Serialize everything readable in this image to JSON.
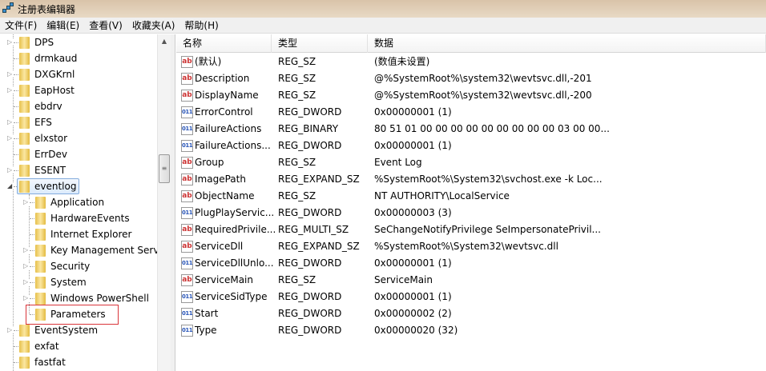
{
  "window": {
    "title": "注册表编辑器"
  },
  "menu": [
    "文件(F)",
    "编辑(E)",
    "查看(V)",
    "收藏夹(A)",
    "帮助(H)"
  ],
  "tree": [
    {
      "label": "DPS",
      "level": 1,
      "expandable": true
    },
    {
      "label": "drmkaud",
      "level": 1,
      "expandable": false
    },
    {
      "label": "DXGKrnl",
      "level": 1,
      "expandable": true
    },
    {
      "label": "EapHost",
      "level": 1,
      "expandable": true
    },
    {
      "label": "ebdrv",
      "level": 1,
      "expandable": false
    },
    {
      "label": "EFS",
      "level": 1,
      "expandable": true
    },
    {
      "label": "elxstor",
      "level": 1,
      "expandable": true
    },
    {
      "label": "ErrDev",
      "level": 1,
      "expandable": false
    },
    {
      "label": "ESENT",
      "level": 1,
      "expandable": true
    },
    {
      "label": "eventlog",
      "level": 1,
      "expandable": true,
      "expanded": true,
      "selected": true
    },
    {
      "label": "Application",
      "level": 2,
      "expandable": true
    },
    {
      "label": "HardwareEvents",
      "level": 2,
      "expandable": false
    },
    {
      "label": "Internet Explorer",
      "level": 2,
      "expandable": false
    },
    {
      "label": "Key Management Servi",
      "level": 2,
      "expandable": true
    },
    {
      "label": "Security",
      "level": 2,
      "expandable": true
    },
    {
      "label": "System",
      "level": 2,
      "expandable": true
    },
    {
      "label": "Windows PowerShell",
      "level": 2,
      "expandable": true
    },
    {
      "label": "Parameters",
      "level": 2,
      "expandable": false,
      "highlighted": true
    },
    {
      "label": "EventSystem",
      "level": 1,
      "expandable": true
    },
    {
      "label": "exfat",
      "level": 1,
      "expandable": false
    },
    {
      "label": "fastfat",
      "level": 1,
      "expandable": false
    }
  ],
  "columns": {
    "name": "名称",
    "type": "类型",
    "data": "数据"
  },
  "values": [
    {
      "icon": "string",
      "name": "(默认)",
      "type": "REG_SZ",
      "data": "(数值未设置)"
    },
    {
      "icon": "string",
      "name": "Description",
      "type": "REG_SZ",
      "data": "@%SystemRoot%\\system32\\wevtsvc.dll,-201"
    },
    {
      "icon": "string",
      "name": "DisplayName",
      "type": "REG_SZ",
      "data": "@%SystemRoot%\\system32\\wevtsvc.dll,-200"
    },
    {
      "icon": "binary",
      "name": "ErrorControl",
      "type": "REG_DWORD",
      "data": "0x00000001 (1)"
    },
    {
      "icon": "binary",
      "name": "FailureActions",
      "type": "REG_BINARY",
      "data": "80 51 01 00 00 00 00 00 00 00 00 00 03 00 00..."
    },
    {
      "icon": "binary",
      "name": "FailureActions...",
      "type": "REG_DWORD",
      "data": "0x00000001 (1)"
    },
    {
      "icon": "string",
      "name": "Group",
      "type": "REG_SZ",
      "data": "Event Log"
    },
    {
      "icon": "string",
      "name": "ImagePath",
      "type": "REG_EXPAND_SZ",
      "data": "%SystemRoot%\\System32\\svchost.exe -k Loc..."
    },
    {
      "icon": "string",
      "name": "ObjectName",
      "type": "REG_SZ",
      "data": "NT AUTHORITY\\LocalService"
    },
    {
      "icon": "binary",
      "name": "PlugPlayServic...",
      "type": "REG_DWORD",
      "data": "0x00000003 (3)"
    },
    {
      "icon": "string",
      "name": "RequiredPrivile...",
      "type": "REG_MULTI_SZ",
      "data": "SeChangeNotifyPrivilege SeImpersonatePrivil..."
    },
    {
      "icon": "string",
      "name": "ServiceDll",
      "type": "REG_EXPAND_SZ",
      "data": "%SystemRoot%\\System32\\wevtsvc.dll"
    },
    {
      "icon": "binary",
      "name": "ServiceDllUnlo...",
      "type": "REG_DWORD",
      "data": "0x00000001 (1)"
    },
    {
      "icon": "string",
      "name": "ServiceMain",
      "type": "REG_SZ",
      "data": "ServiceMain"
    },
    {
      "icon": "binary",
      "name": "ServiceSidType",
      "type": "REG_DWORD",
      "data": "0x00000001 (1)"
    },
    {
      "icon": "binary",
      "name": "Start",
      "type": "REG_DWORD",
      "data": "0x00000002 (2)"
    },
    {
      "icon": "binary",
      "name": "Type",
      "type": "REG_DWORD",
      "data": "0x00000020 (32)"
    }
  ],
  "colors": {
    "highlight_box": "#d9353a",
    "selection_border": "#84acdd"
  }
}
